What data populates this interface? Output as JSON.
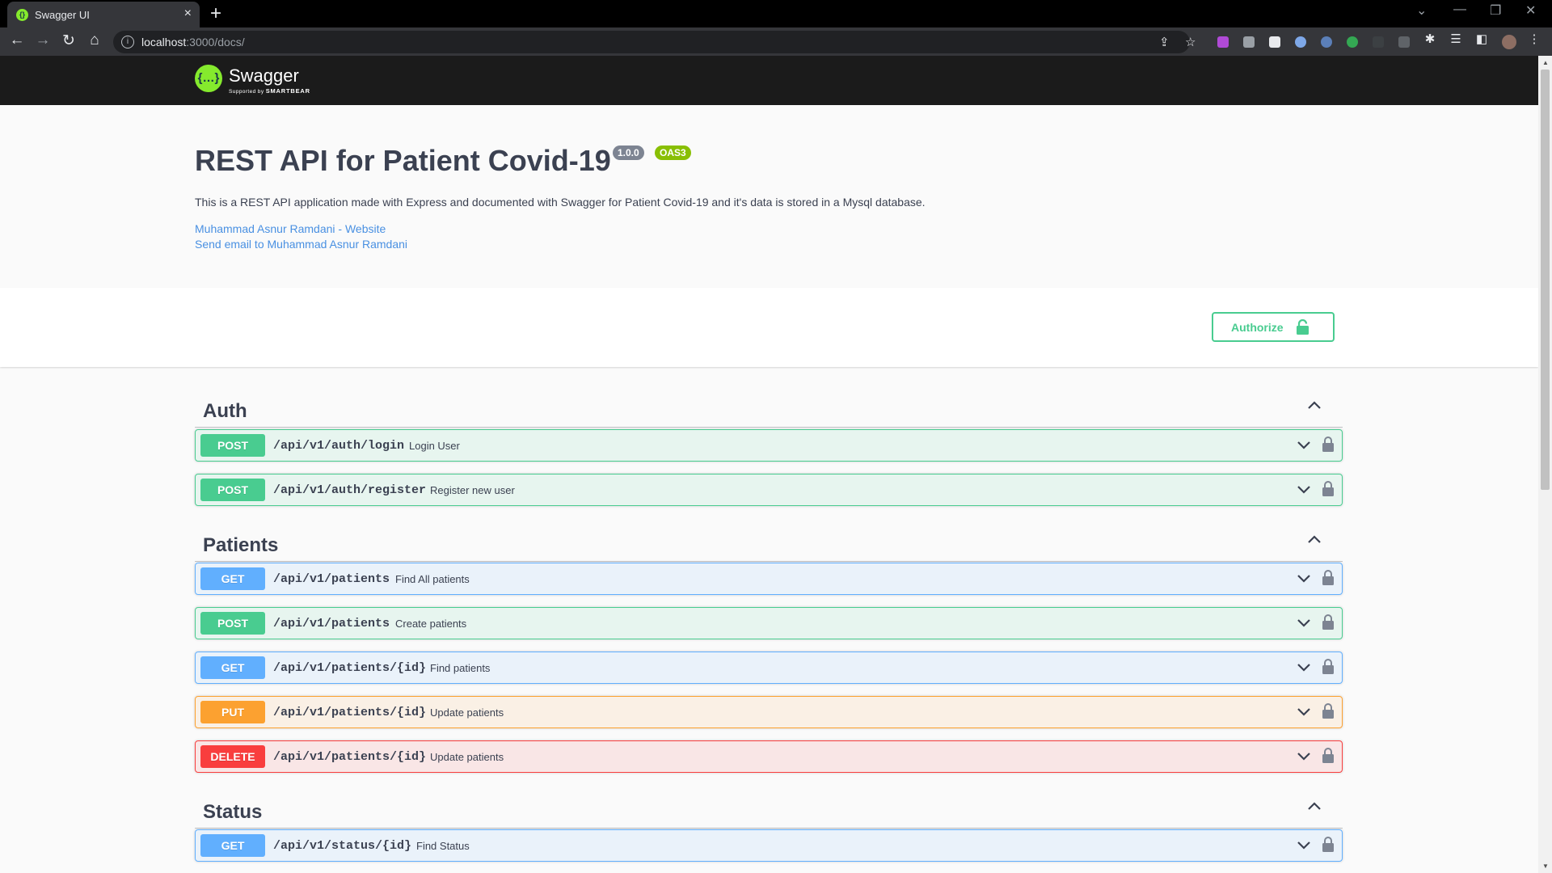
{
  "browser": {
    "tab_title": "Swagger UI",
    "tab_close": "×",
    "new_tab": "+",
    "url_host": "localhost",
    "url_rest": ":3000/docs/"
  },
  "topbar": {
    "logo_mark": "{…}",
    "logo_name": "Swagger",
    "logo_sub": "Supported by",
    "logo_brand": "SMARTBEAR"
  },
  "info": {
    "title": "REST API for Patient Covid-19",
    "version": "1.0.0",
    "oas": "OAS3",
    "description": "This is a REST API application made with Express and documented with Swagger for Patient Covid-19 and it's data is stored in a Mysql database.",
    "website_link": "Muhammad Asnur Ramdani - Website",
    "email_link": "Send email to Muhammad Asnur Ramdani"
  },
  "authorize": {
    "label": "Authorize"
  },
  "tags": [
    {
      "name": "Auth",
      "operations": [
        {
          "method": "POST",
          "path": "/api/v1/auth/login",
          "summary": "Login User"
        },
        {
          "method": "POST",
          "path": "/api/v1/auth/register",
          "summary": "Register new user"
        }
      ]
    },
    {
      "name": "Patients",
      "operations": [
        {
          "method": "GET",
          "path": "/api/v1/patients",
          "summary": "Find All patients"
        },
        {
          "method": "POST",
          "path": "/api/v1/patients",
          "summary": "Create patients"
        },
        {
          "method": "GET",
          "path": "/api/v1/patients/{id}",
          "summary": "Find patients"
        },
        {
          "method": "PUT",
          "path": "/api/v1/patients/{id}",
          "summary": "Update patients"
        },
        {
          "method": "DELETE",
          "path": "/api/v1/patients/{id}",
          "summary": "Update patients"
        }
      ]
    },
    {
      "name": "Status",
      "operations": [
        {
          "method": "GET",
          "path": "/api/v1/status/{id}",
          "summary": "Find Status"
        }
      ]
    }
  ],
  "colors": {
    "post": "#49cc90",
    "get": "#61affe",
    "put": "#fca130",
    "delete": "#f93e3e",
    "swagger_green": "#85ea2d",
    "text": "#3b4151"
  }
}
